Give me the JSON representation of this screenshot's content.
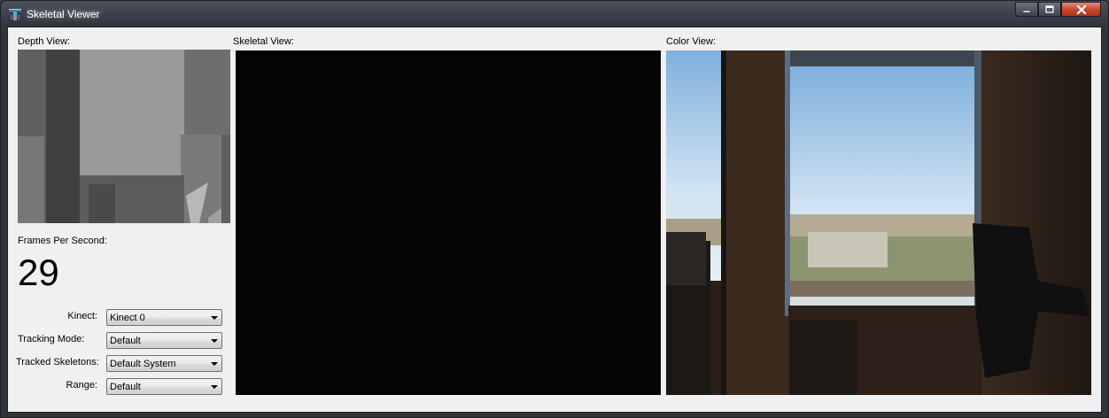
{
  "window": {
    "title": "Skeletal Viewer",
    "icons": [
      "app-icon",
      "minimize-icon",
      "maximize-icon",
      "close-icon"
    ]
  },
  "depth": {
    "label": "Depth View:"
  },
  "skeletal": {
    "label": "Skeletal View:"
  },
  "color": {
    "label": "Color View:"
  },
  "fps": {
    "label": "Frames Per Second:",
    "value": "29"
  },
  "settings": {
    "kinect_label": "Kinect:",
    "kinect_value": "Kinect 0",
    "tracking_mode_label": "Tracking Mode:",
    "tracking_mode_value": "Default",
    "tracked_skeletons_label": "Tracked Skeletons:",
    "tracked_skeletons_value": "Default System",
    "range_label": "Range:",
    "range_value": "Default"
  }
}
